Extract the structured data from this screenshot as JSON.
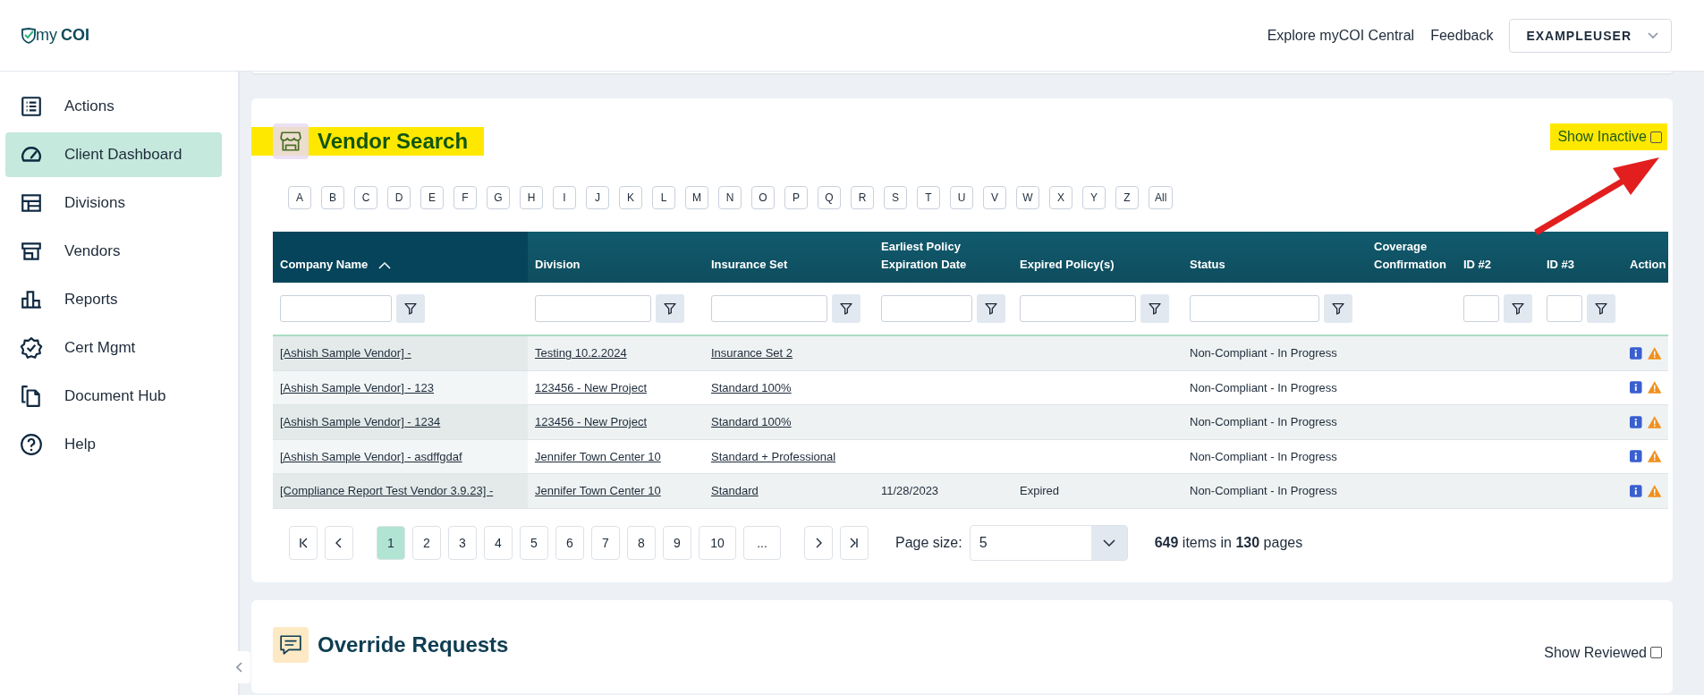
{
  "header": {
    "logo": "my**COI**",
    "links": [
      "Explore myCOI Central",
      "Feedback"
    ],
    "user": "EXAMPLEUSER"
  },
  "nav": {
    "items": [
      {
        "label": "Actions",
        "selected": false
      },
      {
        "label": "Client Dashboard",
        "selected": true
      },
      {
        "label": "Divisions",
        "selected": false
      },
      {
        "label": "Vendors",
        "selected": false
      },
      {
        "label": "Reports",
        "selected": false
      },
      {
        "label": "Cert Mgmt",
        "selected": false
      },
      {
        "label": "Document Hub",
        "selected": false
      },
      {
        "label": "Help",
        "selected": false
      }
    ]
  },
  "vendor_search": {
    "title": "Vendor Search",
    "show_inactive": {
      "label": "Show Inactive",
      "checked": false
    },
    "letters": [
      "A",
      "B",
      "C",
      "D",
      "E",
      "F",
      "G",
      "H",
      "I",
      "J",
      "K",
      "L",
      "M",
      "N",
      "O",
      "P",
      "Q",
      "R",
      "S",
      "T",
      "U",
      "V",
      "W",
      "X",
      "Y",
      "Z",
      "All"
    ],
    "columns": [
      {
        "label": "Company Name",
        "sorted": true,
        "filter": true
      },
      {
        "label": "Division",
        "sorted": false,
        "filter": true
      },
      {
        "label": "Insurance Set",
        "sorted": false,
        "filter": true
      },
      {
        "label": "Earliest Policy Expiration Date",
        "sorted": false,
        "filter": true
      },
      {
        "label": "Expired Policy(s)",
        "sorted": false,
        "filter": true
      },
      {
        "label": "Status",
        "sorted": false,
        "filter": true
      },
      {
        "label": "Coverage Confirmation",
        "sorted": false,
        "filter": false
      },
      {
        "label": "ID #2",
        "sorted": false,
        "filter": true
      },
      {
        "label": "ID #3",
        "sorted": false,
        "filter": true
      },
      {
        "label": "Action",
        "sorted": false,
        "filter": false
      }
    ],
    "rows": [
      {
        "company": "[Ashish Sample Vendor] -",
        "division": "Testing 10.2.2024",
        "insurance_set": "Insurance Set 2",
        "earliest": "",
        "expired": "",
        "status": "Non-Compliant - In Progress"
      },
      {
        "company": "[Ashish Sample Vendor] - 123",
        "division": "123456 - New Project",
        "insurance_set": "Standard 100%",
        "earliest": "",
        "expired": "",
        "status": "Non-Compliant - In Progress"
      },
      {
        "company": "[Ashish Sample Vendor] - 1234",
        "division": "123456 - New Project",
        "insurance_set": "Standard 100%",
        "earliest": "",
        "expired": "",
        "status": "Non-Compliant - In Progress"
      },
      {
        "company": "[Ashish Sample Vendor] - asdffgdaf",
        "division": "Jennifer Town Center 10",
        "insurance_set": "Standard + Professional",
        "earliest": "",
        "expired": "",
        "status": "Non-Compliant - In Progress"
      },
      {
        "company": "[Compliance Report Test Vendor 3.9.23] -",
        "division": "Jennifer Town Center 10",
        "insurance_set": "Standard",
        "earliest": "11/28/2023",
        "expired": "Expired",
        "status": "Non-Compliant - In Progress"
      }
    ],
    "pager": {
      "pages": [
        {
          "label": "1",
          "selected": true
        },
        {
          "label": "2",
          "selected": false
        },
        {
          "label": "3",
          "selected": false
        },
        {
          "label": "4",
          "selected": false
        },
        {
          "label": "5",
          "selected": false
        },
        {
          "label": "6",
          "selected": false
        },
        {
          "label": "7",
          "selected": false
        },
        {
          "label": "8",
          "selected": false
        },
        {
          "label": "9",
          "selected": false
        },
        {
          "label": "10",
          "selected": false
        },
        {
          "label": "...",
          "selected": false
        }
      ],
      "page_size_label": "Page size:",
      "page_size": "5",
      "summary": "**649** items in **130** pages"
    }
  },
  "override_requests": {
    "title": "Override Requests",
    "show_reviewed": {
      "label": "Show Reviewed",
      "checked": false
    }
  }
}
